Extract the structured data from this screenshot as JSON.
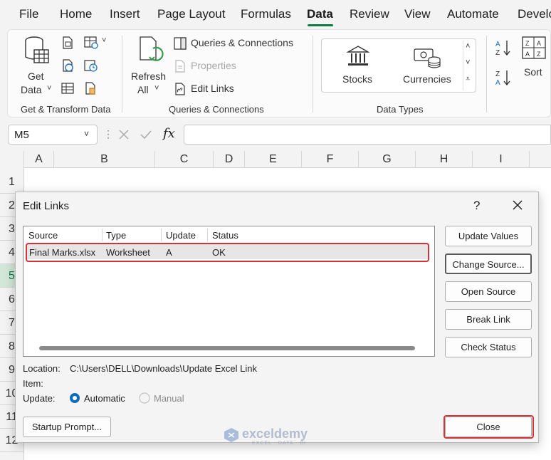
{
  "menu": {
    "tabs": [
      "File",
      "Home",
      "Insert",
      "Page Layout",
      "Formulas",
      "Data",
      "Review",
      "View",
      "Automate",
      "Develo"
    ],
    "active": "Data"
  },
  "ribbon": {
    "get_data": {
      "line1": "Get",
      "line2": "Data"
    },
    "get_transform_label": "Get & Transform Data",
    "refresh_all": {
      "line1": "Refresh",
      "line2": "All"
    },
    "queries_connections_btn": "Queries & Connections",
    "properties_btn": "Properties",
    "edit_links_btn": "Edit Links",
    "queries_group_label": "Queries & Connections",
    "stocks_label": "Stocks",
    "currencies_label": "Currencies",
    "data_types_label": "Data Types",
    "sort_label": "Sort"
  },
  "formula_bar": {
    "name_box": "M5",
    "fx": "fx",
    "value": ""
  },
  "grid": {
    "columns": [
      "A",
      "B",
      "C",
      "D",
      "E",
      "F",
      "G",
      "H",
      "I"
    ],
    "rows": [
      "1",
      "2",
      "3",
      "4",
      "5",
      "6",
      "7",
      "8",
      "9",
      "10",
      "11",
      "12"
    ],
    "selected_row": "5"
  },
  "dialog": {
    "title": "Edit Links",
    "help": "?",
    "list": {
      "headers": [
        "Source",
        "Type",
        "Update",
        "Status"
      ],
      "rows": [
        {
          "source": "Final Marks.xlsx",
          "type": "Worksheet",
          "update": "A",
          "status": "OK"
        }
      ]
    },
    "buttons": {
      "update_values": "Update Values",
      "change_source": "Change Source...",
      "open_source": "Open Source",
      "break_link": "Break Link",
      "check_status": "Check Status",
      "startup_prompt": "Startup Prompt...",
      "close": "Close"
    },
    "location_label": "Location:",
    "location_value": "C:\\Users\\DELL\\Downloads\\Update Excel Link",
    "item_label": "Item:",
    "update_label": "Update:",
    "automatic_label": "Automatic",
    "manual_label": "Manual",
    "update_mode": "Automatic"
  },
  "watermark": {
    "brand": "exceldemy",
    "tagline": "EXCEL · DATA · BI"
  },
  "colors": {
    "accent": "#107c41",
    "highlight": "#d6323a",
    "radio": "#0f6cbd"
  }
}
